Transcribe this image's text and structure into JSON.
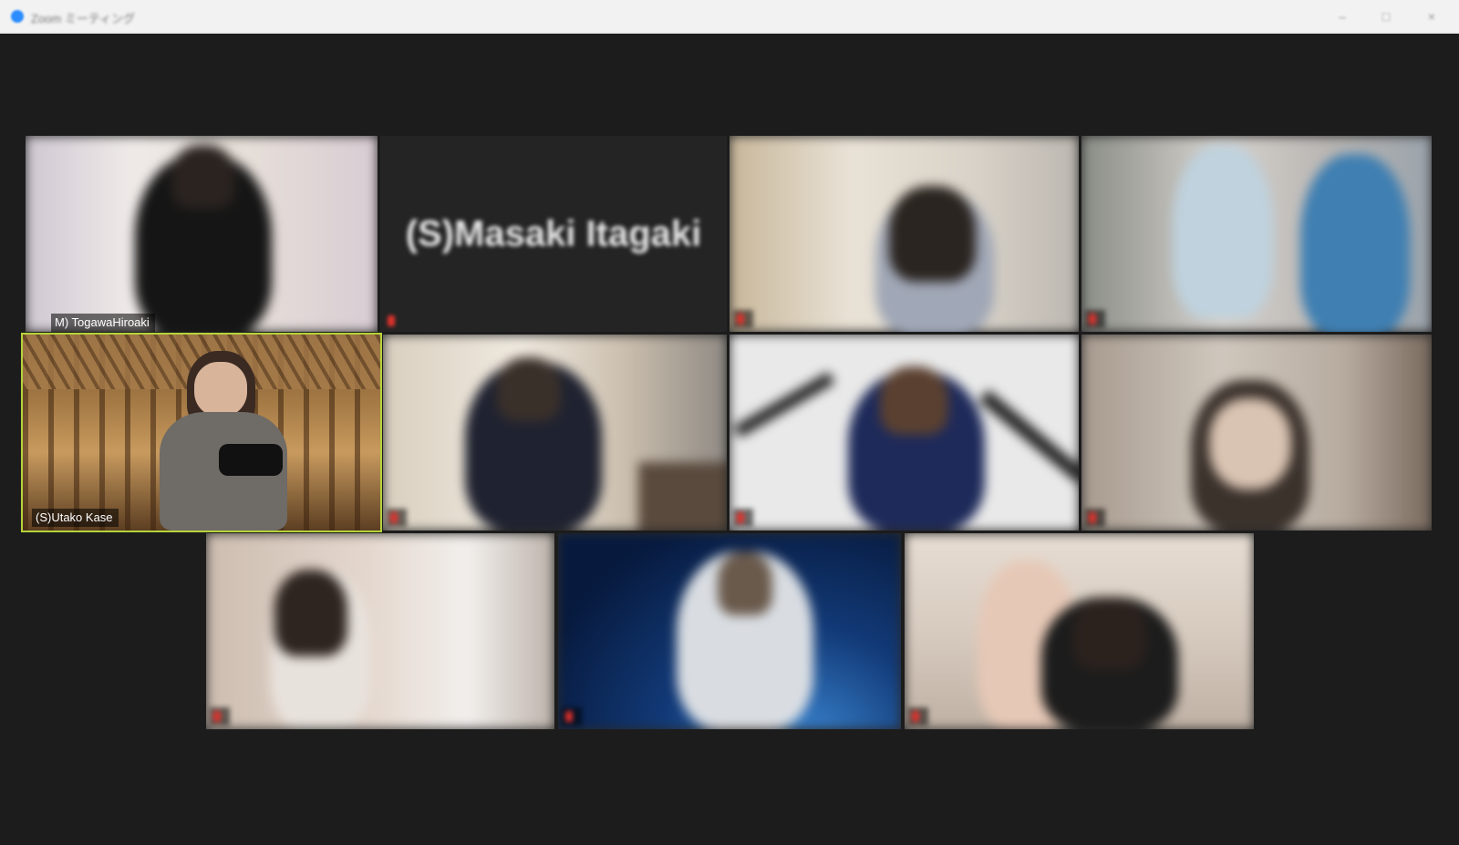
{
  "window": {
    "title": "Zoom ミーティング"
  },
  "participants": [
    {
      "name": "M) TogawaHiroaki"
    },
    {
      "name": "(S)Masaki Itagaki"
    },
    {
      "name": ""
    },
    {
      "name": ""
    },
    {
      "name": "(S)Utako Kase"
    },
    {
      "name": ""
    },
    {
      "name": ""
    },
    {
      "name": ""
    },
    {
      "name": ""
    },
    {
      "name": ""
    },
    {
      "name": ""
    }
  ],
  "colors": {
    "active_speaker_border": "#b6d33a",
    "mute": "#e0322c"
  }
}
